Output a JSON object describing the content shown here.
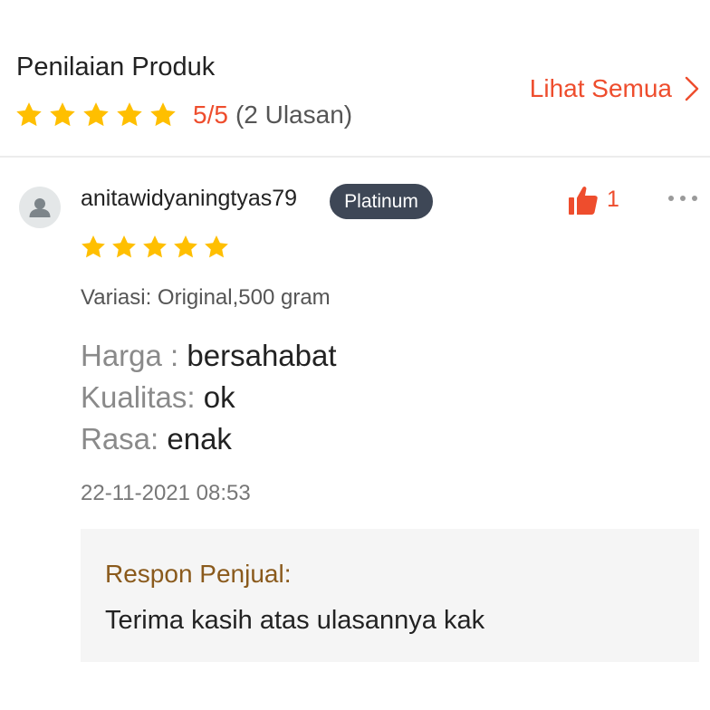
{
  "product_rating": {
    "title": "Penilaian Produk",
    "score": "5/5",
    "review_count": "(2 Ulasan)",
    "star_count": 5,
    "see_all_label": "Lihat Semua"
  },
  "review": {
    "username": "anitawidyaningtyas79",
    "badge": "Platinum",
    "likes": "1",
    "rating": 5,
    "variation": "Variasi: Original,500 gram",
    "attributes": [
      {
        "key": "Harga : ",
        "value": "bersahabat"
      },
      {
        "key": "Kualitas: ",
        "value": "ok"
      },
      {
        "key": "Rasa: ",
        "value": "enak"
      }
    ],
    "timestamp": "22-11-2021 08:53",
    "seller_response": {
      "label": "Respon Penjual:",
      "text": "Terima kasih atas ulasannya kak"
    }
  },
  "colors": {
    "accent": "#ee4d2d",
    "star": "#ffbf00",
    "badge_bg": "#3e4756",
    "seller_label": "#8a5a1c",
    "seller_box_bg": "#f5f5f5"
  },
  "icons": {
    "star": "star-icon",
    "see_all": "chevron-right-icon",
    "avatar": "user-silhouette-icon",
    "like": "thumbs-up-icon",
    "more": "more-horizontal-icon"
  }
}
